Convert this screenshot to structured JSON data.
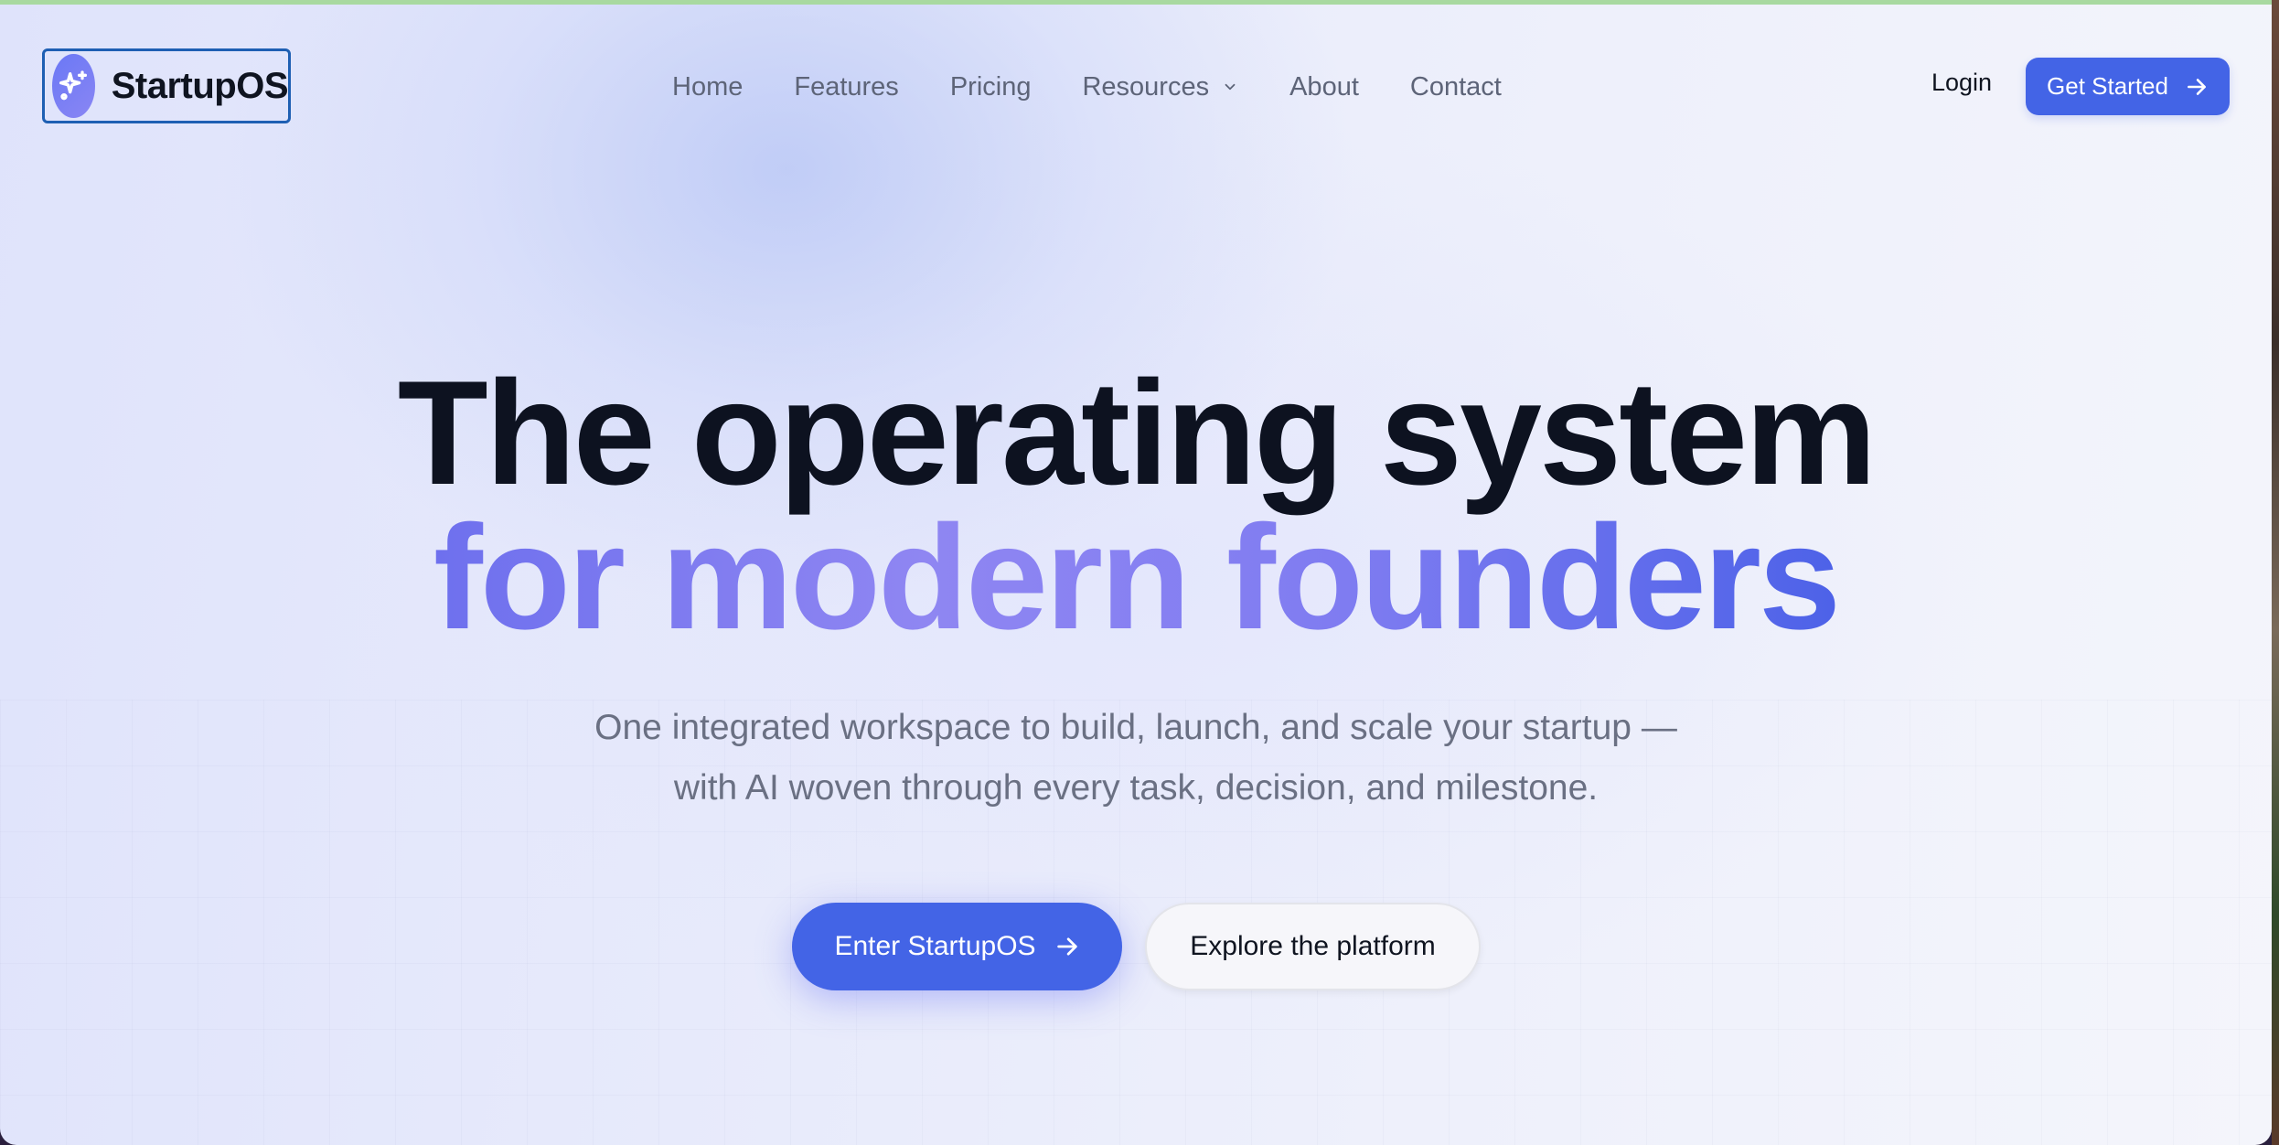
{
  "brand": {
    "name": "StartupOS",
    "icon": "sparkles-icon"
  },
  "nav": {
    "items": [
      {
        "label": "Home"
      },
      {
        "label": "Features"
      },
      {
        "label": "Pricing"
      },
      {
        "label": "Resources",
        "icon": "chevron-down-icon"
      },
      {
        "label": "About"
      },
      {
        "label": "Contact"
      }
    ],
    "login_label": "Login",
    "cta_label": "Get Started",
    "cta_icon": "arrow-right-icon"
  },
  "hero": {
    "line1": "The operating system",
    "line2": "for modern founders",
    "subtitle_line1": "One integrated workspace to build, launch, and scale your startup —",
    "subtitle_line2": "with AI woven through every task, decision, and milestone.",
    "primary_cta": "Enter StartupOS",
    "primary_cta_icon": "arrow-right-icon",
    "secondary_cta": "Explore the platform"
  },
  "colors": {
    "accent": "#4364e6",
    "gradient_start": "#6e70ee",
    "gradient_end": "#4d62e8",
    "text_dark": "#0d1220",
    "text_muted": "#6a7083",
    "focus_outline": "#1e5fb3"
  }
}
